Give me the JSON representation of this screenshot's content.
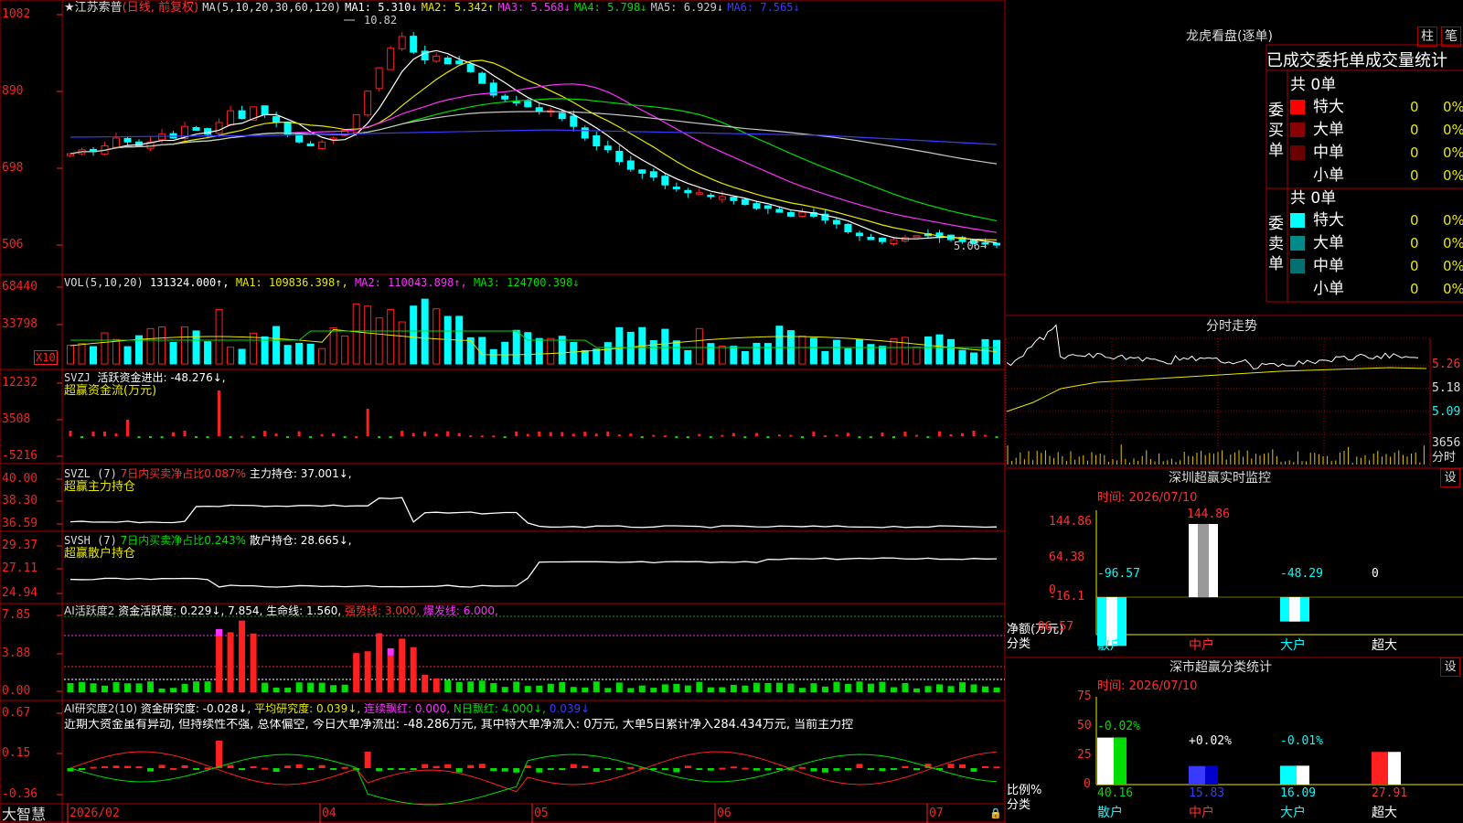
{
  "colors": {
    "up": "#ff2020",
    "down": "#00ffff",
    "ma1": "#ffffff",
    "ma2": "#e8e800",
    "ma3": "#ff30ff",
    "ma4": "#00dd00",
    "ma5": "#c8c8c8",
    "ma6": "#3a3aff",
    "grid": "#aa0000",
    "axis": "#ff2020"
  },
  "main": {
    "stock_name": "江苏索普",
    "period": "(日线, 前复权)",
    "ma_header": "MA(5,10,20,30,60,120)",
    "ma1": "MA1: 5.310↓",
    "ma2": "MA2: 5.342↑",
    "ma3": "MA3: 5.568↓",
    "ma4": "MA4: 5.798↓",
    "ma5": "MA5: 6.929↓",
    "ma6": "MA6: 7.565↓",
    "y_ticks": [
      "1082",
      "890",
      "698",
      "506"
    ],
    "high_label": "10.82",
    "low_label": "5.06→"
  },
  "vol": {
    "header": "VOL(5,10,20)",
    "value": "131324.000↑,",
    "ma1": "MA1: 109836.398↑,",
    "ma2": "MA2: 110043.898↑,",
    "ma3": "MA3: 124700.398↓",
    "y_ticks": [
      "68440",
      "33798"
    ],
    "unit": "X10"
  },
  "svzj": {
    "header": "SVZJ",
    "title": "活跃资金进出: -48.276↓,",
    "subtitle": "超赢资金流(万元)",
    "y_ticks": [
      "12232",
      "3508",
      "-5216"
    ]
  },
  "svzl": {
    "header": "SVZL (7)",
    "ratio": "7日内买卖净占比0.087%",
    "hold": "主力持仓: 37.001↓,",
    "subtitle": "超赢主力持仓",
    "y_ticks": [
      "40.00",
      "38.30",
      "36.59"
    ]
  },
  "svsh": {
    "header": "SVSH (7)",
    "ratio": "7日内买卖净占比0.243%",
    "hold": "散户持仓: 28.665↓,",
    "subtitle": "超赢散户持仓",
    "y_ticks": [
      "29.37",
      "27.11",
      "24.94"
    ]
  },
  "aiactive": {
    "header": "AI活跃度2",
    "v1": "资金活跃度: 0.229↓,",
    "v2": "7.854,",
    "v3": "生命线: 1.560,",
    "v4": "强势线: 3.000,",
    "v5": "爆发线: 6.000,",
    "y_ticks": [
      "7.85",
      "3.88",
      "0.00"
    ]
  },
  "airesearch": {
    "header": "AI研究度2(10)",
    "v1": "资金研究度: -0.028↓,",
    "v2": "平均研究度: 0.039↓,",
    "v3": "连续飘红: 0.000,",
    "v4": "N日飘红: 4.000↓,",
    "v5": "0.039↓",
    "comment": "近期大资金虽有异动, 但持续性不强, 总体偏空, 今日大单净流出: -48.286万元, 其中特大单净流入: 0万元, 大单5日累计净入284.434万元, 当前主力控",
    "y_ticks": [
      "0.67",
      "0.15",
      "-0.36"
    ]
  },
  "xaxis": {
    "brand": "大智慧",
    "labels": [
      "2026/02",
      "04",
      "05",
      "06",
      "07"
    ]
  },
  "right": {
    "dragon_title": "龙虎看盘(逐单)",
    "btn1": "柱",
    "btn2": "笔",
    "stats_title": "已成交委托单成交量统计",
    "buy": {
      "label": "委买单",
      "total": "共 0单",
      "rows": [
        {
          "name": "特大",
          "v": "0",
          "p": "0%",
          "c": "#ff0000"
        },
        {
          "name": "大单",
          "v": "0",
          "p": "0%",
          "c": "#8b0000"
        },
        {
          "name": "中单",
          "v": "0",
          "p": "0%",
          "c": "#6a0000"
        },
        {
          "name": "小单",
          "v": "0",
          "p": "0%",
          "c": "#000000"
        }
      ]
    },
    "sell": {
      "label": "委卖单",
      "total": "共 0单",
      "rows": [
        {
          "name": "特大",
          "v": "0",
          "p": "0%",
          "c": "#00ffff"
        },
        {
          "name": "大单",
          "v": "0",
          "p": "0%",
          "c": "#008b8b"
        },
        {
          "name": "中单",
          "v": "0",
          "p": "0%",
          "c": "#007070"
        },
        {
          "name": "小单",
          "v": "0",
          "p": "0%",
          "c": "#000000"
        }
      ]
    },
    "intraday": {
      "title": "分时走势",
      "y_ticks": [
        "5.26",
        "5.18",
        "5.09"
      ],
      "vol_label": "3656",
      "vol_unit": "分时"
    },
    "monitor": {
      "title": "深圳超赢实时监控",
      "btn": "设",
      "time": "时间: 2026/07/10",
      "top_label": "144.86",
      "y_ticks": [
        "144.86",
        "64.38",
        "0",
        "-16.1",
        "-96.57"
      ],
      "values": [
        "-96.57",
        "",
        "-48.29",
        "0"
      ],
      "cats": [
        "散户",
        "中户",
        "大户",
        "超大"
      ],
      "ylabel": "净额(万元)",
      "xlabel": "分类"
    },
    "classify": {
      "title": "深市超赢分类统计",
      "btn": "设",
      "time": "时间: 2026/07/10",
      "y_ticks": [
        "75",
        "50",
        "25",
        "0"
      ],
      "pct": [
        "-0.02%",
        "+0.02%",
        "-0.01%",
        ""
      ],
      "vals": [
        "40.16",
        "15.83",
        "16.09",
        "27.91"
      ],
      "cats": [
        "散户",
        "中户",
        "大户",
        "超大"
      ],
      "ylabel": "比例%",
      "xlabel": "分类"
    }
  },
  "chart_data": [
    {
      "type": "candlestick",
      "title": "江苏索普 (日线, 前复权)",
      "y_ticks": [
        1082,
        890,
        698,
        506
      ],
      "high": 10.82,
      "low": 5.06,
      "ma": [
        {
          "name": "MA1",
          "value": 5.31
        },
        {
          "name": "MA2",
          "value": 5.342
        },
        {
          "name": "MA3",
          "value": 5.568
        },
        {
          "name": "MA4",
          "value": 5.798
        },
        {
          "name": "MA5",
          "value": 6.929
        },
        {
          "name": "MA6",
          "value": 7.565
        }
      ],
      "closes": [
        7.4,
        7.5,
        7.45,
        7.6,
        7.8,
        7.7,
        7.6,
        7.7,
        7.9,
        7.8,
        8.1,
        8.0,
        7.9,
        8.2,
        8.5,
        8.3,
        8.6,
        8.4,
        8.2,
        7.9,
        7.7,
        7.6,
        7.7,
        7.8,
        8.0,
        8.4,
        9.0,
        9.6,
        10.1,
        10.4,
        10.0,
        9.8,
        9.9,
        9.7,
        9.7,
        9.5,
        9.2,
        8.9,
        8.8,
        8.7,
        8.6,
        8.5,
        8.5,
        8.3,
        8.1,
        7.8,
        7.6,
        7.5,
        7.2,
        7.0,
        6.9,
        6.8,
        6.6,
        6.5,
        6.4,
        6.4,
        6.3,
        6.3,
        6.2,
        6.1,
        6.0,
        6.0,
        5.9,
        5.8,
        5.9,
        5.8,
        5.7,
        5.6,
        5.4,
        5.3,
        5.2,
        5.15,
        5.2,
        5.25,
        5.3,
        5.3,
        5.25,
        5.2,
        5.15,
        5.1,
        5.1,
        5.06
      ]
    },
    {
      "type": "bar",
      "title": "VOL(5,10,20)",
      "y_ticks": [
        68440,
        33798
      ],
      "values": [
        131324.0
      ],
      "ma": [
        109836.398,
        110043.898,
        124700.398
      ]
    },
    {
      "type": "bar",
      "title": "SVZJ 活跃资金进出",
      "y_ticks": [
        12232,
        3508,
        -5216
      ],
      "values": [
        -48.276
      ]
    },
    {
      "type": "line",
      "title": "SVZL 主力持仓",
      "y_ticks": [
        40.0,
        38.3,
        36.59
      ],
      "values": [
        37.001
      ]
    },
    {
      "type": "line",
      "title": "SVSH 散户持仓",
      "y_ticks": [
        29.37,
        27.11,
        24.94
      ],
      "values": [
        28.665
      ]
    },
    {
      "type": "bar",
      "title": "AI活跃度2",
      "y_ticks": [
        7.85,
        3.88,
        0.0
      ],
      "values": [
        0.229,
        7.854,
        1.56,
        3.0,
        6.0
      ]
    },
    {
      "type": "bar",
      "title": "AI研究度2(10)",
      "y_ticks": [
        0.67,
        0.15,
        -0.36
      ],
      "values": [
        -0.028,
        0.039,
        0.0,
        4.0,
        0.039
      ]
    },
    {
      "type": "bar",
      "title": "深圳超赢实时监控",
      "categories": [
        "散户",
        "中户",
        "大户",
        "超大"
      ],
      "values": [
        -96.57,
        144.86,
        -48.29,
        0
      ],
      "ylim": [
        -96.57,
        144.86
      ]
    },
    {
      "type": "bar",
      "title": "深市超赢分类统计",
      "categories": [
        "散户",
        "中户",
        "大户",
        "超大"
      ],
      "values": [
        40.16,
        15.83,
        16.09,
        27.91
      ],
      "ylim": [
        0,
        75
      ]
    }
  ]
}
